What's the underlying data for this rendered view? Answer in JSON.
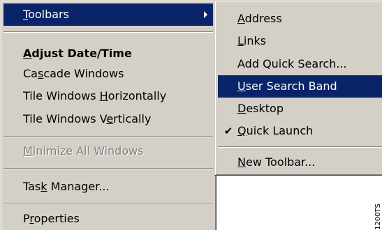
{
  "main_menu": {
    "items": [
      {
        "label_pre": "",
        "label_ul": "T",
        "label_post": "oolbars",
        "has_submenu": true
      },
      {
        "label_pre": "",
        "label_ul": "A",
        "label_post": "djust Date/Time"
      },
      {
        "label_pre": "Ca",
        "label_ul": "s",
        "label_post": "cade Windows"
      },
      {
        "label_pre": "Tile Windows ",
        "label_ul": "H",
        "label_post": "orizontally"
      },
      {
        "label_pre": "Tile Windows V",
        "label_ul": "e",
        "label_post": "rtically"
      },
      {
        "label_pre": "",
        "label_ul": "M",
        "label_post": "inimize All Windows"
      },
      {
        "label_pre": "Tas",
        "label_ul": "k",
        "label_post": " Manager..."
      },
      {
        "label_pre": "P",
        "label_ul": "r",
        "label_post": "operties"
      }
    ]
  },
  "toolbars_submenu": {
    "items": [
      {
        "label_pre": "",
        "label_ul": "A",
        "label_post": "ddress"
      },
      {
        "label_pre": "",
        "label_ul": "L",
        "label_post": "inks"
      },
      {
        "label_pre": "Add Quick Search...",
        "label_ul": "",
        "label_post": ""
      },
      {
        "label_pre": "",
        "label_ul": "U",
        "label_post": "ser Search Band"
      },
      {
        "label_pre": "",
        "label_ul": "D",
        "label_post": "esktop"
      },
      {
        "label_pre": "",
        "label_ul": "Q",
        "label_post": "uick Launch",
        "checked": true,
        "check_glyph": "✔"
      },
      {
        "label_pre": "",
        "label_ul": "N",
        "label_post": "ew Toolbar..."
      }
    ]
  },
  "side_text": "1200TS",
  "colors": {
    "menu_bg": "#d4d0c8",
    "highlight_bg": "#0a246a",
    "highlight_fg": "#ffffff",
    "disabled_fg": "#808080"
  }
}
